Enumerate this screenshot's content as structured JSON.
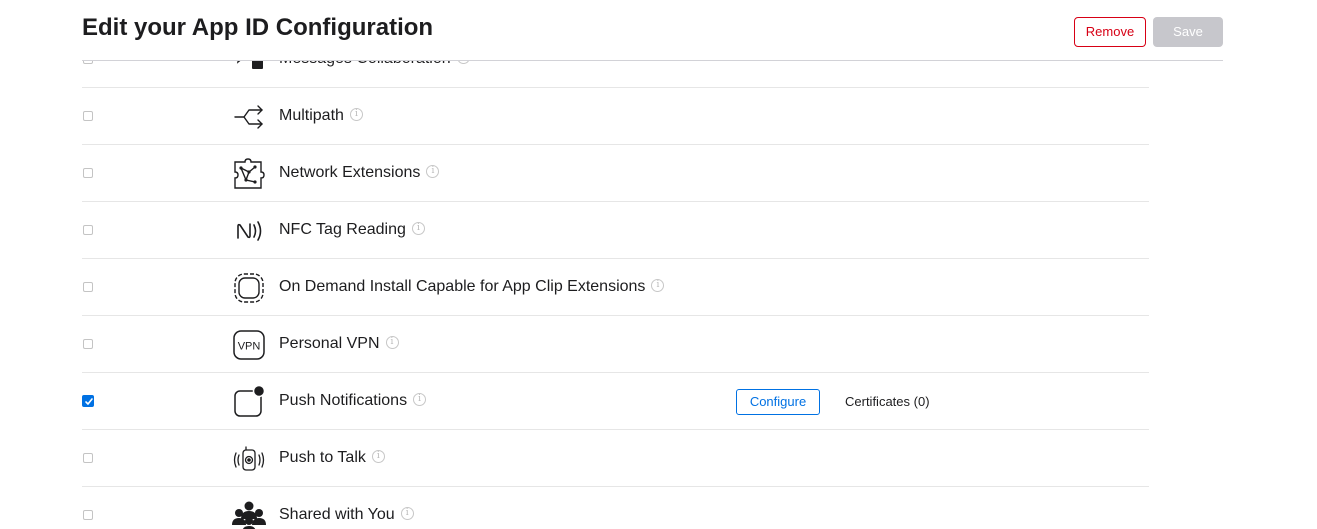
{
  "header": {
    "title": "Edit your App ID Configuration",
    "remove_label": "Remove",
    "save_label": "Save"
  },
  "capabilities": [
    {
      "label": "Messages Collaboration",
      "icon": "messages-collaboration-icon",
      "checked": false
    },
    {
      "label": "Multipath",
      "icon": "multipath-icon",
      "checked": false
    },
    {
      "label": "Network Extensions",
      "icon": "network-extensions-icon",
      "checked": false
    },
    {
      "label": "NFC Tag Reading",
      "icon": "nfc-icon",
      "checked": false
    },
    {
      "label": "On Demand Install Capable for App Clip Extensions",
      "icon": "app-clip-icon",
      "checked": false
    },
    {
      "label": "Personal VPN",
      "icon": "vpn-icon",
      "checked": false
    },
    {
      "label": "Push Notifications",
      "icon": "push-notifications-icon",
      "checked": true,
      "configure_label": "Configure",
      "certificates_label": "Certificates (0)"
    },
    {
      "label": "Push to Talk",
      "icon": "push-to-talk-icon",
      "checked": false
    },
    {
      "label": "Shared with You",
      "icon": "shared-with-you-icon",
      "checked": false
    }
  ],
  "info_glyph": "i",
  "colors": {
    "accent": "#0071e3",
    "danger": "#d70015",
    "disabled": "#c7c7cc"
  }
}
